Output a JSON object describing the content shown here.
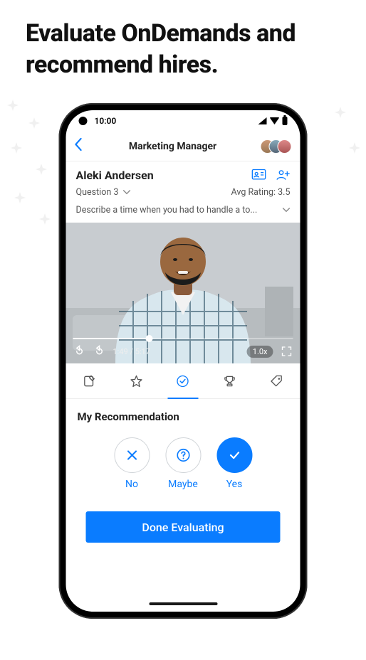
{
  "headline": "Evaluate OnDemands and recommend hires.",
  "status": {
    "time": "10:00"
  },
  "nav": {
    "title": "Marketing Manager"
  },
  "candidate": {
    "name": "Aleki Andersen",
    "question_selector": "Question 3",
    "avg_rating_label": "Avg Rating: 3.5",
    "question_text": "Describe a time when you had to handle a to..."
  },
  "video": {
    "time_display": "1:49 / 5:17",
    "speed": "1.0x"
  },
  "recommendation": {
    "section_title": "My Recommendation",
    "options": {
      "no": "No",
      "maybe": "Maybe",
      "yes": "Yes"
    }
  },
  "done_button": "Done Evaluating"
}
